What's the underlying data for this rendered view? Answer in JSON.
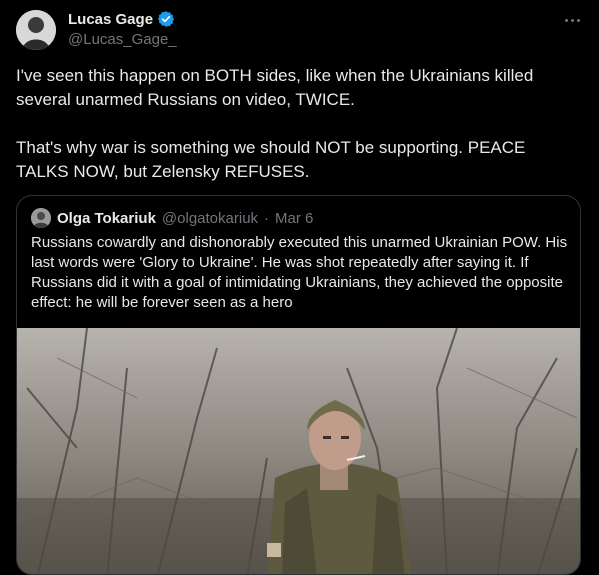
{
  "author": {
    "display_name": "Lucas Gage",
    "handle": "@Lucas_Gage_",
    "verified": true,
    "verified_color": "#1d9bf0"
  },
  "tweet": {
    "text": "I've seen this happen on BOTH sides, like when the Ukrainians killed several unarmed Russians on video, TWICE.\n\nThat's why war is something we should NOT be supporting. PEACE TALKS NOW, but Zelensky REFUSES."
  },
  "quote": {
    "display_name": "Olga Tokariuk",
    "handle": "@olgatokariuk",
    "separator": "·",
    "date": "Mar 6",
    "text": "Russians cowardly and dishonorably executed this unarmed Ukrainian POW. His last words were 'Glory to Ukraine'. He was shot repeatedly after saying it. If Russians did it with a goal of intimidating Ukrainians, they achieved the opposite effect: he will be forever seen as a hero"
  },
  "icons": {
    "more": "more-horizontal-icon",
    "verified": "verified-badge-icon"
  }
}
